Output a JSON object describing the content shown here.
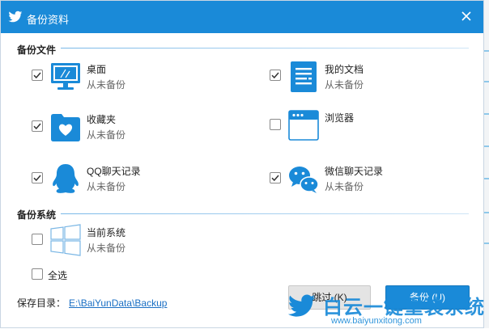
{
  "window": {
    "title": "备份资料"
  },
  "sections": {
    "files_title": "备份文件",
    "system_title": "备份系统"
  },
  "items": {
    "desktop": {
      "name": "桌面",
      "status": "从未备份",
      "checked": true,
      "icon": "monitor-icon"
    },
    "documents": {
      "name": "我的文档",
      "status": "从未备份",
      "checked": true,
      "icon": "document-icon"
    },
    "favorites": {
      "name": "收藏夹",
      "status": "从未备份",
      "checked": true,
      "icon": "folder-heart-icon"
    },
    "browser": {
      "name": "浏览器",
      "status": "",
      "checked": false,
      "icon": "browser-window-icon"
    },
    "qq": {
      "name": "QQ聊天记录",
      "status": "从未备份",
      "checked": true,
      "icon": "qq-penguin-icon"
    },
    "wechat": {
      "name": "微信聊天记录",
      "status": "从未备份",
      "checked": true,
      "icon": "wechat-icon"
    },
    "system": {
      "name": "当前系统",
      "status": "从未备份",
      "checked": false,
      "icon": "windows-logo-icon"
    }
  },
  "select_all": {
    "label": "全选",
    "checked": false
  },
  "save_path": {
    "label": "保存目录：",
    "path": "E:\\BaiYunData\\Backup"
  },
  "buttons": {
    "skip": "跳过 (K)",
    "backup": "备份 (U)"
  },
  "watermark": {
    "name": "白云一键重装系统",
    "url": "www.baiyunxitong.com"
  },
  "colors": {
    "accent": "#1a8ad8",
    "link": "#1a6fc4"
  }
}
